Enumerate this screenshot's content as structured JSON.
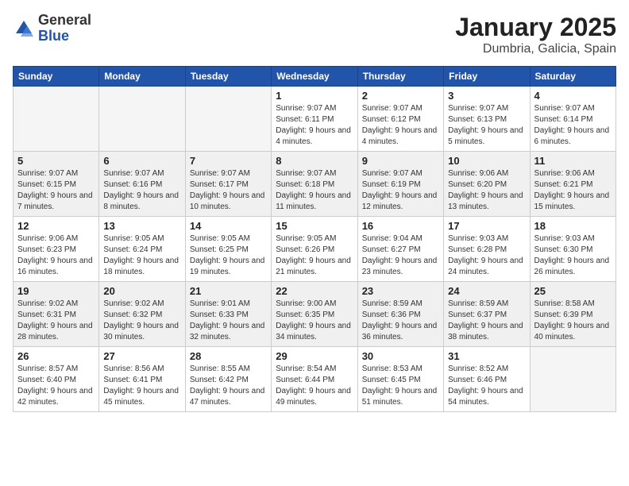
{
  "header": {
    "logo_general": "General",
    "logo_blue": "Blue",
    "title": "January 2025",
    "subtitle": "Dumbria, Galicia, Spain"
  },
  "weekdays": [
    "Sunday",
    "Monday",
    "Tuesday",
    "Wednesday",
    "Thursday",
    "Friday",
    "Saturday"
  ],
  "weeks": [
    {
      "shaded": false,
      "days": [
        {
          "num": "",
          "empty": true
        },
        {
          "num": "",
          "empty": true
        },
        {
          "num": "",
          "empty": true
        },
        {
          "num": "1",
          "sunrise": "Sunrise: 9:07 AM",
          "sunset": "Sunset: 6:11 PM",
          "daylight": "Daylight: 9 hours and 4 minutes."
        },
        {
          "num": "2",
          "sunrise": "Sunrise: 9:07 AM",
          "sunset": "Sunset: 6:12 PM",
          "daylight": "Daylight: 9 hours and 4 minutes."
        },
        {
          "num": "3",
          "sunrise": "Sunrise: 9:07 AM",
          "sunset": "Sunset: 6:13 PM",
          "daylight": "Daylight: 9 hours and 5 minutes."
        },
        {
          "num": "4",
          "sunrise": "Sunrise: 9:07 AM",
          "sunset": "Sunset: 6:14 PM",
          "daylight": "Daylight: 9 hours and 6 minutes."
        }
      ]
    },
    {
      "shaded": true,
      "days": [
        {
          "num": "5",
          "sunrise": "Sunrise: 9:07 AM",
          "sunset": "Sunset: 6:15 PM",
          "daylight": "Daylight: 9 hours and 7 minutes."
        },
        {
          "num": "6",
          "sunrise": "Sunrise: 9:07 AM",
          "sunset": "Sunset: 6:16 PM",
          "daylight": "Daylight: 9 hours and 8 minutes."
        },
        {
          "num": "7",
          "sunrise": "Sunrise: 9:07 AM",
          "sunset": "Sunset: 6:17 PM",
          "daylight": "Daylight: 9 hours and 10 minutes."
        },
        {
          "num": "8",
          "sunrise": "Sunrise: 9:07 AM",
          "sunset": "Sunset: 6:18 PM",
          "daylight": "Daylight: 9 hours and 11 minutes."
        },
        {
          "num": "9",
          "sunrise": "Sunrise: 9:07 AM",
          "sunset": "Sunset: 6:19 PM",
          "daylight": "Daylight: 9 hours and 12 minutes."
        },
        {
          "num": "10",
          "sunrise": "Sunrise: 9:06 AM",
          "sunset": "Sunset: 6:20 PM",
          "daylight": "Daylight: 9 hours and 13 minutes."
        },
        {
          "num": "11",
          "sunrise": "Sunrise: 9:06 AM",
          "sunset": "Sunset: 6:21 PM",
          "daylight": "Daylight: 9 hours and 15 minutes."
        }
      ]
    },
    {
      "shaded": false,
      "days": [
        {
          "num": "12",
          "sunrise": "Sunrise: 9:06 AM",
          "sunset": "Sunset: 6:23 PM",
          "daylight": "Daylight: 9 hours and 16 minutes."
        },
        {
          "num": "13",
          "sunrise": "Sunrise: 9:05 AM",
          "sunset": "Sunset: 6:24 PM",
          "daylight": "Daylight: 9 hours and 18 minutes."
        },
        {
          "num": "14",
          "sunrise": "Sunrise: 9:05 AM",
          "sunset": "Sunset: 6:25 PM",
          "daylight": "Daylight: 9 hours and 19 minutes."
        },
        {
          "num": "15",
          "sunrise": "Sunrise: 9:05 AM",
          "sunset": "Sunset: 6:26 PM",
          "daylight": "Daylight: 9 hours and 21 minutes."
        },
        {
          "num": "16",
          "sunrise": "Sunrise: 9:04 AM",
          "sunset": "Sunset: 6:27 PM",
          "daylight": "Daylight: 9 hours and 23 minutes."
        },
        {
          "num": "17",
          "sunrise": "Sunrise: 9:03 AM",
          "sunset": "Sunset: 6:28 PM",
          "daylight": "Daylight: 9 hours and 24 minutes."
        },
        {
          "num": "18",
          "sunrise": "Sunrise: 9:03 AM",
          "sunset": "Sunset: 6:30 PM",
          "daylight": "Daylight: 9 hours and 26 minutes."
        }
      ]
    },
    {
      "shaded": true,
      "days": [
        {
          "num": "19",
          "sunrise": "Sunrise: 9:02 AM",
          "sunset": "Sunset: 6:31 PM",
          "daylight": "Daylight: 9 hours and 28 minutes."
        },
        {
          "num": "20",
          "sunrise": "Sunrise: 9:02 AM",
          "sunset": "Sunset: 6:32 PM",
          "daylight": "Daylight: 9 hours and 30 minutes."
        },
        {
          "num": "21",
          "sunrise": "Sunrise: 9:01 AM",
          "sunset": "Sunset: 6:33 PM",
          "daylight": "Daylight: 9 hours and 32 minutes."
        },
        {
          "num": "22",
          "sunrise": "Sunrise: 9:00 AM",
          "sunset": "Sunset: 6:35 PM",
          "daylight": "Daylight: 9 hours and 34 minutes."
        },
        {
          "num": "23",
          "sunrise": "Sunrise: 8:59 AM",
          "sunset": "Sunset: 6:36 PM",
          "daylight": "Daylight: 9 hours and 36 minutes."
        },
        {
          "num": "24",
          "sunrise": "Sunrise: 8:59 AM",
          "sunset": "Sunset: 6:37 PM",
          "daylight": "Daylight: 9 hours and 38 minutes."
        },
        {
          "num": "25",
          "sunrise": "Sunrise: 8:58 AM",
          "sunset": "Sunset: 6:39 PM",
          "daylight": "Daylight: 9 hours and 40 minutes."
        }
      ]
    },
    {
      "shaded": false,
      "days": [
        {
          "num": "26",
          "sunrise": "Sunrise: 8:57 AM",
          "sunset": "Sunset: 6:40 PM",
          "daylight": "Daylight: 9 hours and 42 minutes."
        },
        {
          "num": "27",
          "sunrise": "Sunrise: 8:56 AM",
          "sunset": "Sunset: 6:41 PM",
          "daylight": "Daylight: 9 hours and 45 minutes."
        },
        {
          "num": "28",
          "sunrise": "Sunrise: 8:55 AM",
          "sunset": "Sunset: 6:42 PM",
          "daylight": "Daylight: 9 hours and 47 minutes."
        },
        {
          "num": "29",
          "sunrise": "Sunrise: 8:54 AM",
          "sunset": "Sunset: 6:44 PM",
          "daylight": "Daylight: 9 hours and 49 minutes."
        },
        {
          "num": "30",
          "sunrise": "Sunrise: 8:53 AM",
          "sunset": "Sunset: 6:45 PM",
          "daylight": "Daylight: 9 hours and 51 minutes."
        },
        {
          "num": "31",
          "sunrise": "Sunrise: 8:52 AM",
          "sunset": "Sunset: 6:46 PM",
          "daylight": "Daylight: 9 hours and 54 minutes."
        },
        {
          "num": "",
          "empty": true
        }
      ]
    }
  ]
}
